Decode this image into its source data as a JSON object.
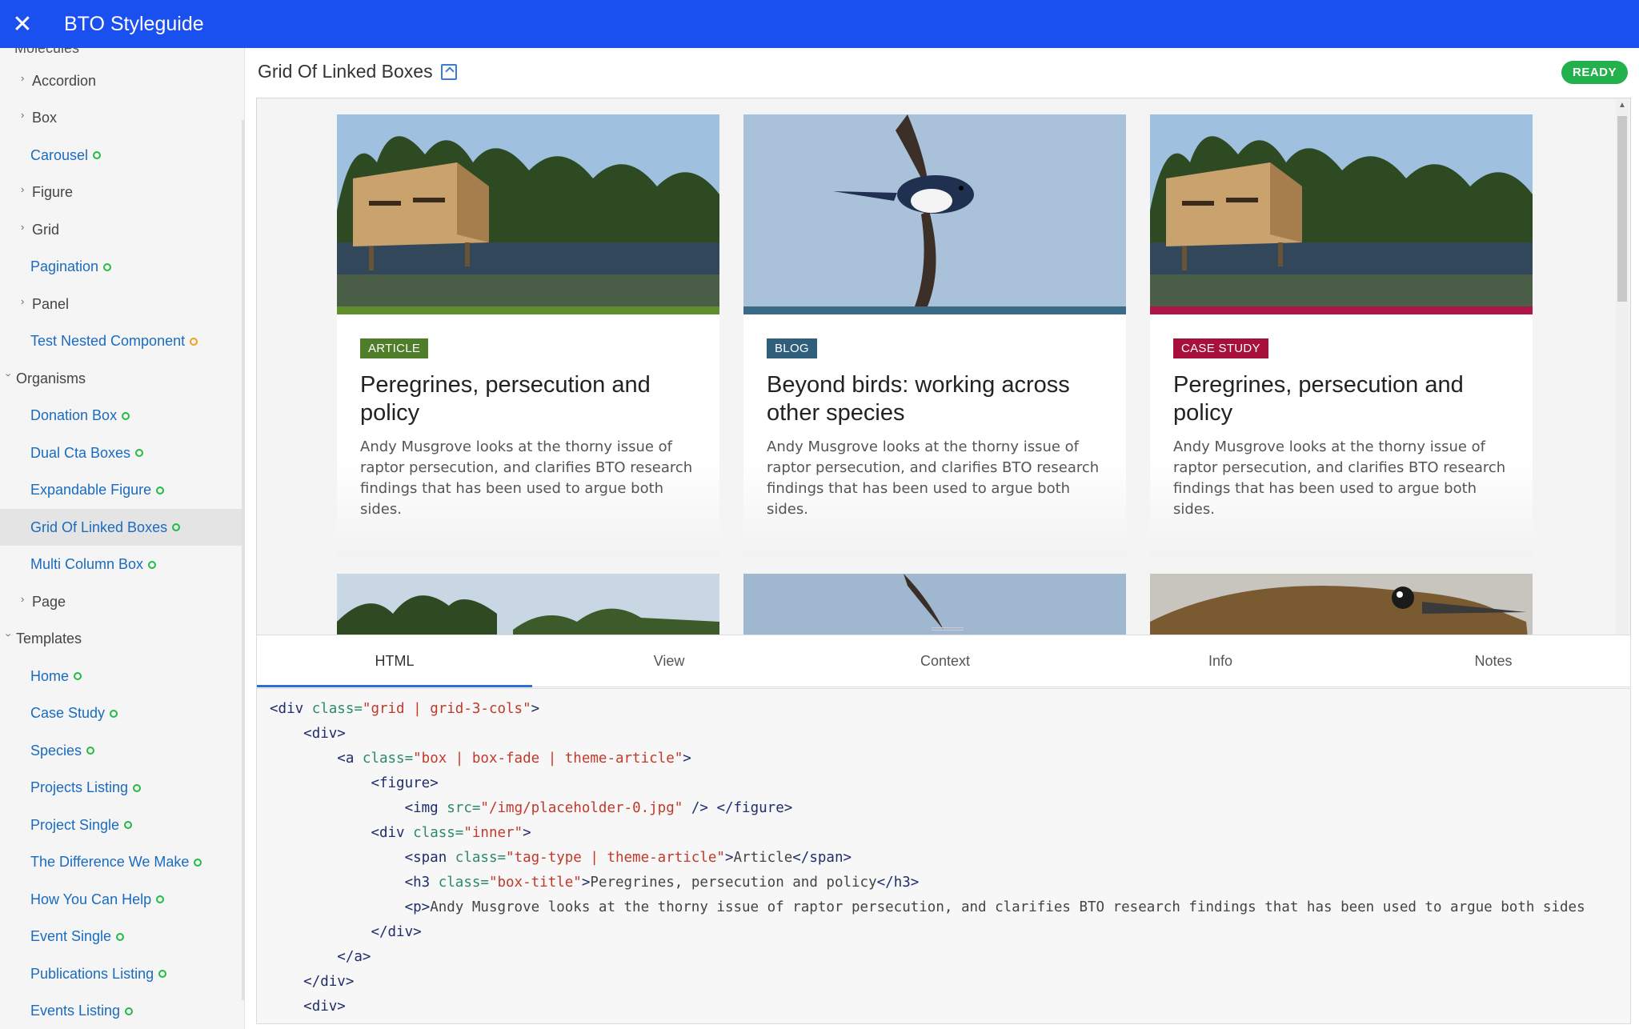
{
  "app": {
    "title": "BTO Styleguide",
    "close_icon": "close-icon"
  },
  "sidebar": {
    "cut_label": "Molecules",
    "items": [
      {
        "label": "Accordion",
        "kind": "group",
        "indent": 1,
        "expanded": false
      },
      {
        "label": "Box",
        "kind": "group",
        "indent": 1,
        "expanded": false
      },
      {
        "label": "Carousel",
        "kind": "link",
        "indent": 2,
        "dot": true
      },
      {
        "label": "Figure",
        "kind": "group",
        "indent": 1,
        "expanded": false
      },
      {
        "label": "Grid",
        "kind": "group",
        "indent": 1,
        "expanded": false
      },
      {
        "label": "Pagination",
        "kind": "link",
        "indent": 2,
        "dot": true
      },
      {
        "label": "Panel",
        "kind": "group",
        "indent": 1,
        "expanded": false
      },
      {
        "label": "Test Nested Component",
        "kind": "link",
        "indent": 2,
        "dot": true,
        "dot_color": "#f0a020"
      },
      {
        "label": "Organisms",
        "kind": "group",
        "indent": 0,
        "expanded": true
      },
      {
        "label": "Donation Box",
        "kind": "link",
        "indent": 2,
        "dot": true
      },
      {
        "label": "Dual Cta Boxes",
        "kind": "link",
        "indent": 2,
        "dot": true
      },
      {
        "label": "Expandable Figure",
        "kind": "link",
        "indent": 2,
        "dot": true
      },
      {
        "label": "Grid Of Linked Boxes",
        "kind": "link",
        "indent": 2,
        "dot": true,
        "active": true
      },
      {
        "label": "Multi Column Box",
        "kind": "link",
        "indent": 2,
        "dot": true
      },
      {
        "label": "Page",
        "kind": "group",
        "indent": 1,
        "expanded": false
      },
      {
        "label": "Templates",
        "kind": "group",
        "indent": 0,
        "expanded": true
      },
      {
        "label": "Home",
        "kind": "link",
        "indent": 2,
        "dot": true
      },
      {
        "label": "Case Study",
        "kind": "link",
        "indent": 2,
        "dot": true
      },
      {
        "label": "Species",
        "kind": "link",
        "indent": 2,
        "dot": true
      },
      {
        "label": "Projects Listing",
        "kind": "link",
        "indent": 2,
        "dot": true
      },
      {
        "label": "Project Single",
        "kind": "link",
        "indent": 2,
        "dot": true
      },
      {
        "label": "The Difference We Make",
        "kind": "link",
        "indent": 2,
        "dot": true
      },
      {
        "label": "How You Can Help",
        "kind": "link",
        "indent": 2,
        "dot": true
      },
      {
        "label": "Event Single",
        "kind": "link",
        "indent": 2,
        "dot": true
      },
      {
        "label": "Publications Listing",
        "kind": "link",
        "indent": 2,
        "dot": true
      },
      {
        "label": "Events Listing",
        "kind": "link",
        "indent": 2,
        "dot": true
      }
    ]
  },
  "main": {
    "title": "Grid Of Linked Boxes",
    "status": "READY",
    "status_color": "#22b14c"
  },
  "cards": [
    {
      "tag": "Article",
      "tag_color": "#4f7d2a",
      "stripe_color": "#5e8f2c",
      "image": "bird-hide",
      "title": "Peregrines, persecution and policy",
      "text": "Andy Musgrove looks at the thorny issue of raptor persecution, and clarifies BTO research findings that has been used to argue both sides."
    },
    {
      "tag": "Blog",
      "tag_color": "#2f5f7a",
      "stripe_color": "#3a6a85",
      "image": "swallow",
      "title": "Beyond birds: working across other species",
      "text": "Andy Musgrove looks at the thorny issue of raptor persecution, and clarifies BTO research findings that has been used to argue both sides."
    },
    {
      "tag": "Case Study",
      "tag_color": "#a8103c",
      "stripe_color": "#b0154a",
      "image": "bird-hide",
      "title": "Peregrines, persecution and policy",
      "text": "Andy Musgrove looks at the thorny issue of raptor persecution, and clarifies BTO research findings that has been used to argue both sides."
    }
  ],
  "tabs": [
    "HTML",
    "View",
    "Context",
    "Info",
    "Notes"
  ],
  "active_tab": "HTML",
  "code_lines": [
    [
      [
        "t",
        "<div "
      ],
      [
        "a",
        "class="
      ],
      [
        "s",
        "\"grid | grid-3-cols\""
      ],
      [
        "t",
        ">"
      ]
    ],
    [
      [
        "i",
        "    "
      ],
      [
        "t",
        "<div>"
      ]
    ],
    [
      [
        "i",
        "        "
      ],
      [
        "t",
        "<a "
      ],
      [
        "a",
        "class="
      ],
      [
        "s",
        "\"box | box-fade | theme-article\""
      ],
      [
        "t",
        ">"
      ]
    ],
    [
      [
        "i",
        "            "
      ],
      [
        "t",
        "<figure>"
      ]
    ],
    [
      [
        "i",
        "                "
      ],
      [
        "t",
        "<img "
      ],
      [
        "a",
        "src="
      ],
      [
        "s",
        "\"/img/placeholder-0.jpg\""
      ],
      [
        "t",
        " /> </figure>"
      ]
    ],
    [
      [
        "i",
        "            "
      ],
      [
        "t",
        "<div "
      ],
      [
        "a",
        "class="
      ],
      [
        "s",
        "\"inner\""
      ],
      [
        "t",
        ">"
      ]
    ],
    [
      [
        "i",
        "                "
      ],
      [
        "t",
        "<span "
      ],
      [
        "a",
        "class="
      ],
      [
        "s",
        "\"tag-type | theme-article\""
      ],
      [
        "t",
        ">"
      ],
      [
        "x",
        "Article"
      ],
      [
        "t",
        "</span>"
      ]
    ],
    [
      [
        "i",
        "                "
      ],
      [
        "t",
        "<h3 "
      ],
      [
        "a",
        "class="
      ],
      [
        "s",
        "\"box-title\""
      ],
      [
        "t",
        ">"
      ],
      [
        "x",
        "Peregrines, persecution and policy"
      ],
      [
        "t",
        "</h3>"
      ]
    ],
    [
      [
        "i",
        "                "
      ],
      [
        "t",
        "<p>"
      ],
      [
        "x",
        "Andy Musgrove looks at the thorny issue of raptor persecution, and clarifies BTO research findings that has been used to argue both sides"
      ]
    ],
    [
      [
        "i",
        "            "
      ],
      [
        "t",
        "</div>"
      ]
    ],
    [
      [
        "i",
        "        "
      ],
      [
        "t",
        "</a>"
      ]
    ],
    [
      [
        "i",
        "    "
      ],
      [
        "t",
        "</div>"
      ]
    ],
    [
      [
        "i",
        "    "
      ],
      [
        "t",
        "<div>"
      ]
    ]
  ]
}
